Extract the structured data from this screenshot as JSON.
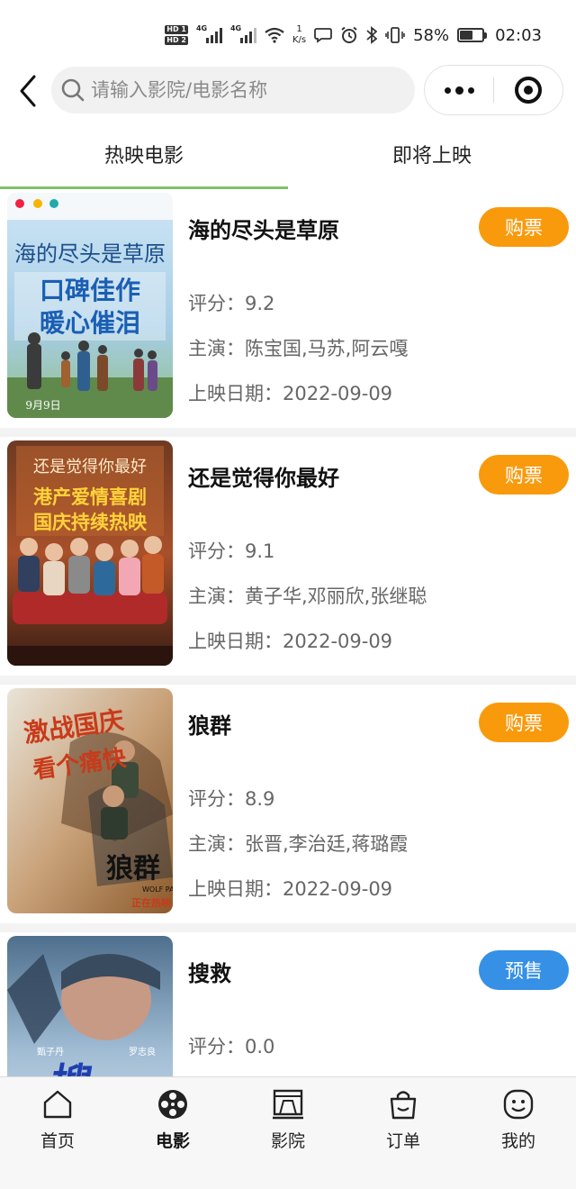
{
  "status_bar": {
    "hd1": "HD 1",
    "hd2": "HD 2",
    "sig1": "4G",
    "sig2": "4G",
    "speed_value": "1",
    "speed_unit": "K/s",
    "battery_percent": "58%",
    "battery_level": 0.58,
    "time": "02:03"
  },
  "header": {
    "search_placeholder": "请输入影院/电影名称"
  },
  "tabs": [
    {
      "label": "热映电影",
      "active": true
    },
    {
      "label": "即将上映",
      "active": false
    }
  ],
  "movies": [
    {
      "title": "海的尽头是草原",
      "score_label": "评分：",
      "score": "9.2",
      "cast_label": "主演：",
      "cast": "陈宝国,马苏,阿云嘎",
      "date_label": "上映日期：",
      "date": "2022-09-09",
      "action": "购票",
      "action_color": "#f99a0c"
    },
    {
      "title": "还是觉得你最好",
      "score_label": "评分：",
      "score": "9.1",
      "cast_label": "主演：",
      "cast": "黄子华,邓丽欣,张继聪",
      "date_label": "上映日期：",
      "date": "2022-09-09",
      "action": "购票",
      "action_color": "#f99a0c"
    },
    {
      "title": "狼群",
      "score_label": "评分：",
      "score": "8.9",
      "cast_label": "主演：",
      "cast": "张晋,李治廷,蒋璐霞",
      "date_label": "上映日期：",
      "date": "2022-09-09",
      "action": "购票",
      "action_color": "#f99a0c"
    },
    {
      "title": "搜救",
      "score_label": "评分：",
      "score": "0.0",
      "action": "预售",
      "action_color": "#3590e6"
    }
  ],
  "posters": [
    {
      "lines": [
        "海的尽头是草原",
        "口碑佳作",
        "暖心催泪"
      ],
      "footer": "9月9日"
    },
    {
      "lines": [
        "还是觉得你最好",
        "港产爱情喜剧",
        "国庆持续热映"
      ]
    },
    {
      "lines": [
        "激战国庆",
        "看个痛快",
        "狼群",
        "WOLF PACK",
        "正在热映"
      ]
    },
    {
      "lines": [
        "甄子丹",
        "罗志良",
        "搜"
      ]
    }
  ],
  "bottom_nav": [
    {
      "label": "首页",
      "icon": "home-icon",
      "active": false
    },
    {
      "label": "电影",
      "icon": "film-reel-icon",
      "active": true
    },
    {
      "label": "影院",
      "icon": "cinema-screen-icon",
      "active": false
    },
    {
      "label": "订单",
      "icon": "shopping-bag-icon",
      "active": false
    },
    {
      "label": "我的",
      "icon": "smiley-profile-icon",
      "active": false
    }
  ]
}
